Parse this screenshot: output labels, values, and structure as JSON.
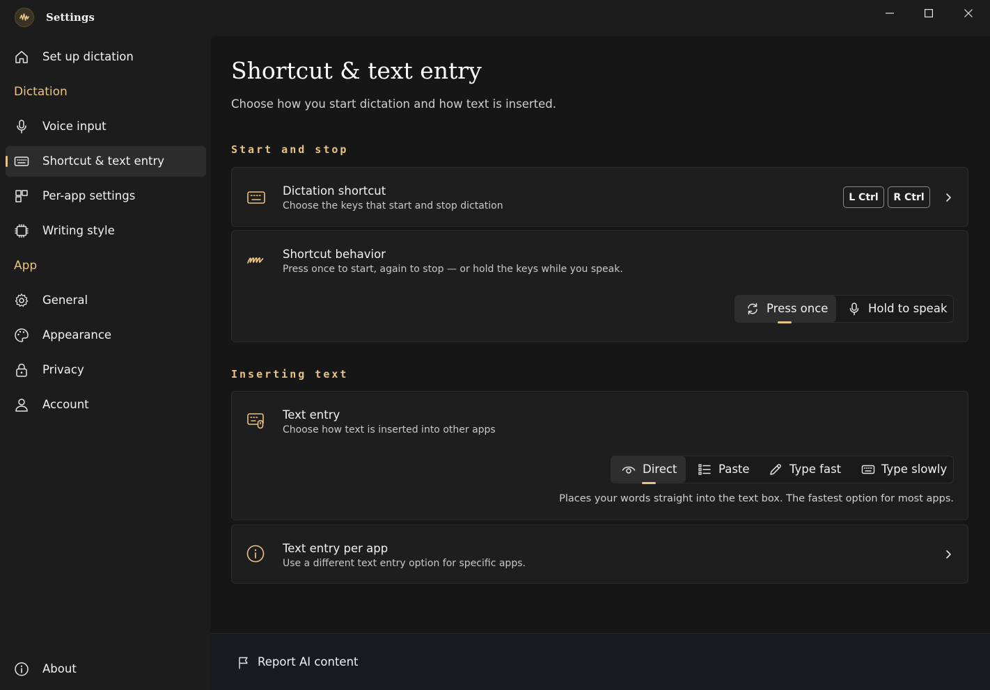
{
  "window": {
    "title": "Settings",
    "controls": [
      "minimize",
      "maximize",
      "close"
    ]
  },
  "sidebar": {
    "top_item": {
      "label": "Set up dictation",
      "icon": "home-icon"
    },
    "sections": [
      {
        "heading": "Dictation",
        "items": [
          {
            "label": "Voice input",
            "icon": "microphone-icon"
          },
          {
            "label": "Shortcut & text entry",
            "icon": "keyboard-icon",
            "active": true
          },
          {
            "label": "Per-app settings",
            "icon": "apps-icon"
          },
          {
            "label": "Writing style",
            "icon": "chip-icon"
          }
        ]
      },
      {
        "heading": "App",
        "items": [
          {
            "label": "General",
            "icon": "gear-icon"
          },
          {
            "label": "Appearance",
            "icon": "palette-icon"
          },
          {
            "label": "Privacy",
            "icon": "lock-icon"
          },
          {
            "label": "Account",
            "icon": "person-icon"
          }
        ]
      }
    ],
    "bottom_item": {
      "label": "About",
      "icon": "info-icon"
    }
  },
  "page": {
    "title": "Shortcut & text entry",
    "subtitle": "Choose how you start dictation and how text is inserted."
  },
  "start_stop": {
    "heading": "Start and stop",
    "dictation_shortcut": {
      "title": "Dictation shortcut",
      "description": "Choose the keys that start and stop dictation",
      "keys": [
        "L Ctrl",
        "R Ctrl"
      ]
    },
    "shortcut_behavior": {
      "title": "Shortcut behavior",
      "description": "Press once to start, again to stop — or hold the keys while you speak.",
      "options": [
        {
          "label": "Press once",
          "icon": "repeat-icon",
          "selected": true
        },
        {
          "label": "Hold to speak",
          "icon": "microphone-icon",
          "selected": false
        }
      ]
    }
  },
  "inserting_text": {
    "heading": "Inserting text",
    "text_entry": {
      "title": "Text entry",
      "description": "Choose how text is inserted into other apps",
      "options": [
        {
          "label": "Direct",
          "icon": "eye-icon",
          "selected": true
        },
        {
          "label": "Paste",
          "icon": "list-icon",
          "selected": false
        },
        {
          "label": "Type fast",
          "icon": "pencil-icon",
          "selected": false
        },
        {
          "label": "Type slowly",
          "icon": "keyboard-icon",
          "selected": false
        }
      ],
      "hint": "Places your words straight into the text box. The fastest option for most apps."
    },
    "text_entry_per_app": {
      "title": "Text entry per app",
      "description": "Use a different text entry option for specific apps."
    }
  },
  "footer": {
    "report_label": "Report AI content"
  },
  "colors": {
    "accent": "#e8c486",
    "background": "#1c1c1c",
    "content_background": "#161616",
    "card_background": "#1e1e1e"
  }
}
